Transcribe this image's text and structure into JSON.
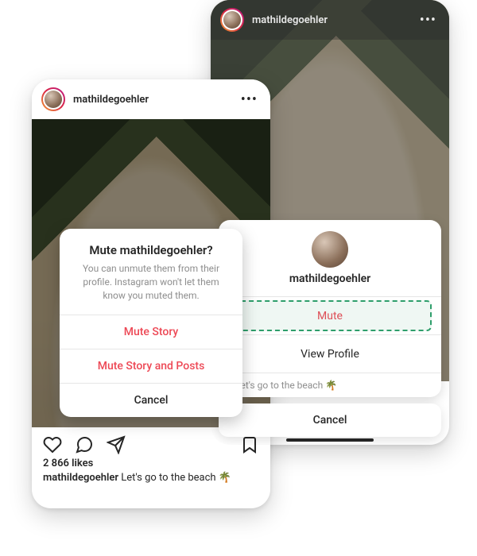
{
  "screenA": {
    "header": {
      "username": "mathildegoehler",
      "more": "•••"
    },
    "dialog": {
      "title": "Mute mathildegoehler?",
      "description": "You can unmute them from their profile. Instagram won't let them know you muted them.",
      "muteStory": "Mute Story",
      "muteStoryPosts": "Mute Story and Posts",
      "cancel": "Cancel"
    },
    "likes": "2 866 likes",
    "caption_user": "mathildegoehler",
    "caption_text": "Let's go to the beach 🌴"
  },
  "screenB": {
    "header": {
      "username": "mathildegoehler",
      "more": "•••"
    },
    "sheet": {
      "username": "mathildegoehler",
      "mute": "Mute",
      "viewProfile": "View Profile",
      "captionLine": "r Let's go to the beach 🌴",
      "cancel": "Cancel"
    }
  }
}
